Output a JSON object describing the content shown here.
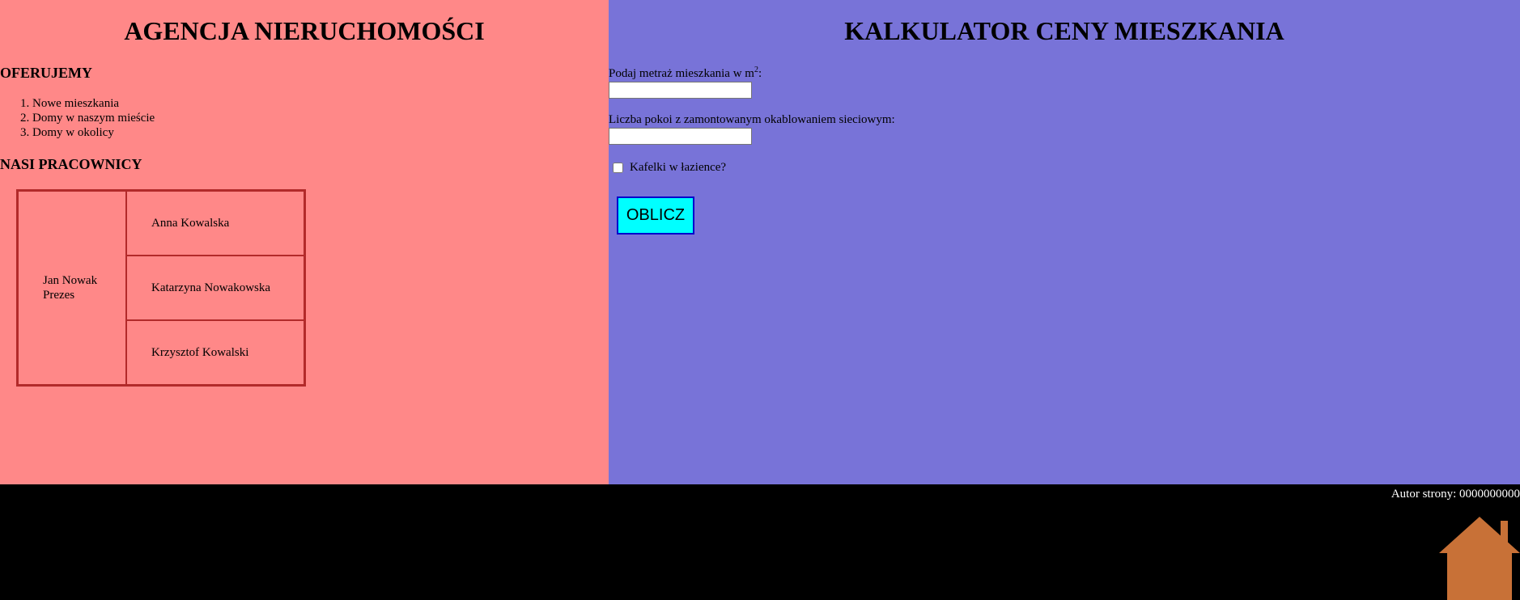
{
  "left": {
    "title": "AGENCJA NIERUCHOMOŚCI",
    "offer_heading": "OFERUJEMY",
    "offers": [
      "Nowe mieszkania",
      "Domy w naszym mieście",
      "Domy w okolicy"
    ],
    "staff_heading": "NASI PRACOWNICY",
    "staff": {
      "boss_name": "Jan Nowak",
      "boss_role": "Prezes",
      "workers": [
        "Anna Kowalska",
        "Katarzyna Nowakowska",
        "Krzysztof Kowalski"
      ]
    }
  },
  "right": {
    "title": "KALKULATOR CENY MIESZKANIA",
    "area_label": "Podaj metraż mieszkania w m",
    "area_sup": "2",
    "area_suffix": ":",
    "area_value": "",
    "rooms_label": "Liczba pokoi z zamontowanym okablowaniem sieciowym:",
    "rooms_value": "",
    "tiles_label": "Kafelki w łazience?",
    "button_label": "OBLICZ"
  },
  "footer": {
    "author": "Autor strony: 0000000000",
    "icon": "home-icon",
    "icon_color": "#c87137"
  },
  "colors": {
    "left_bg": "#ff8888",
    "right_bg": "#7873d8",
    "footer_bg": "#000000",
    "button_bg": "#00ffff",
    "button_border": "#0000cc",
    "table_border": "#b22a2a"
  }
}
